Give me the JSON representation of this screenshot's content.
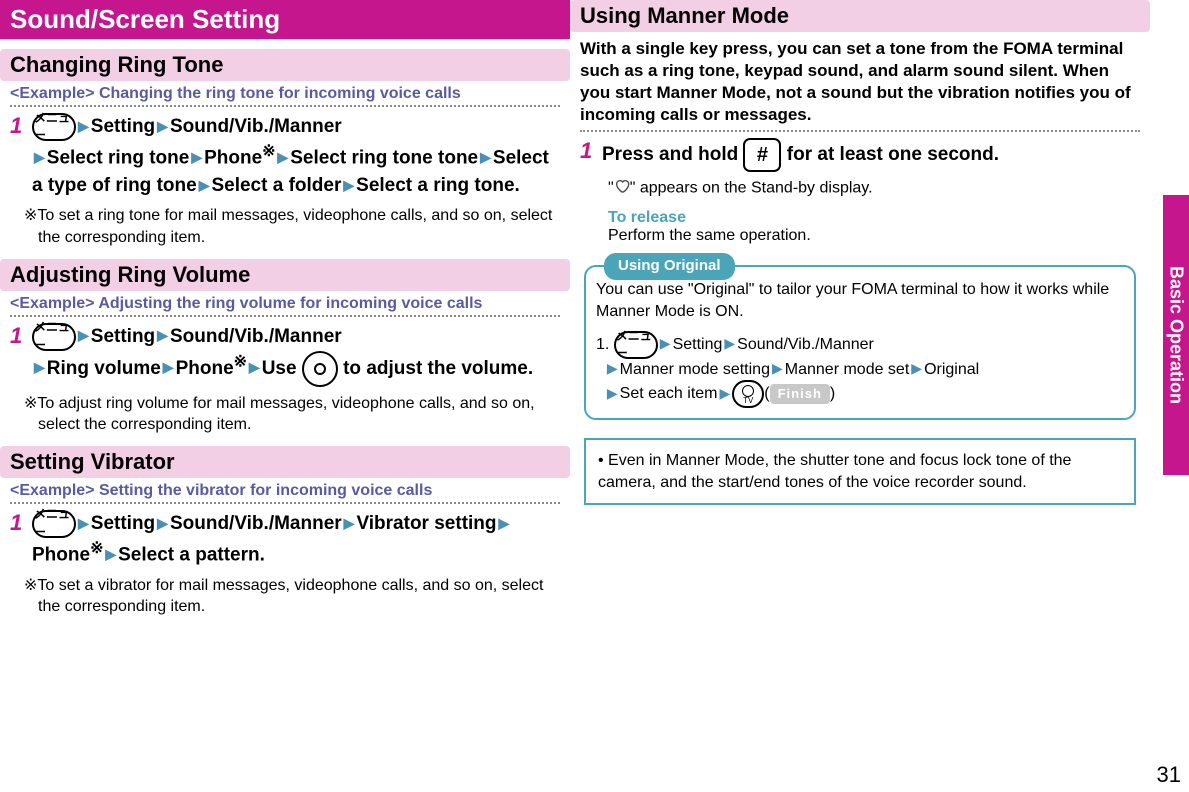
{
  "side_tab": "Basic Operation",
  "page_number": "31",
  "left": {
    "title": "Sound/Screen Setting",
    "sections": [
      {
        "heading": "Changing Ring Tone",
        "example": "<Example> Changing the ring tone for incoming voice calls",
        "step_num": "1",
        "step_parts": [
          "Setting",
          "Sound/Vib./Manner",
          "Select ring tone",
          "Phone",
          "Select ring tone",
          "Select a type of ring tone",
          "Select a folder",
          "Select a ring tone."
        ],
        "asterisk_after_index": 3,
        "note": "※To set a ring tone for mail messages, videophone calls, and so on, select the corresponding item."
      },
      {
        "heading": "Adjusting Ring Volume",
        "example": "<Example> Adjusting the ring volume for incoming voice calls",
        "step_num": "1",
        "step_parts": [
          "Setting",
          "Sound/Vib./Manner",
          "Ring volume",
          "Phone"
        ],
        "trailing": "Use",
        "trailing2": "to adjust the volume.",
        "asterisk_after_index": 3,
        "note": "※To adjust ring volume for mail messages, videophone calls, and so on, select the corresponding item."
      },
      {
        "heading": "Setting Vibrator",
        "example": "<Example> Setting the vibrator for incoming voice calls",
        "step_num": "1",
        "step_parts": [
          "Setting",
          "Sound/Vib./Manner",
          "Vibrator setting",
          "Phone",
          "Select a pattern."
        ],
        "asterisk_after_index": 3,
        "note": "※To set a vibrator for mail messages, videophone calls, and so on, select the corresponding item."
      }
    ]
  },
  "right": {
    "heading": "Using Manner Mode",
    "intro": "With a single key press, you can set a tone from the FOMA terminal such as a ring tone, keypad sound, and alarm sound silent. When you start Manner Mode, not a sound but the vibration notifies you of incoming calls or messages.",
    "step_num": "1",
    "step_text_a": "Press and hold",
    "step_text_b": "for at least one second.",
    "sub_a": "\"",
    "sub_b": "\" appears on the Stand-by display.",
    "to_release_label": "To release",
    "to_release_text": "Perform the same operation.",
    "original": {
      "legend": "Using Original",
      "intro": "You can use \"Original\" to tailor your FOMA terminal to how it works while Manner Mode is ON.",
      "list_num": "1.",
      "parts": [
        "Setting",
        "Sound/Vib./Manner",
        "Manner mode setting",
        "Manner mode set",
        "Original",
        "Set each item"
      ],
      "finish": "Finish"
    },
    "infobox": "Even in Manner Mode, the shutter tone and focus lock tone of the camera, and the start/end tones of the voice recorder sound."
  },
  "labels": {
    "menu_label": "メニュー",
    "hash": "#"
  }
}
